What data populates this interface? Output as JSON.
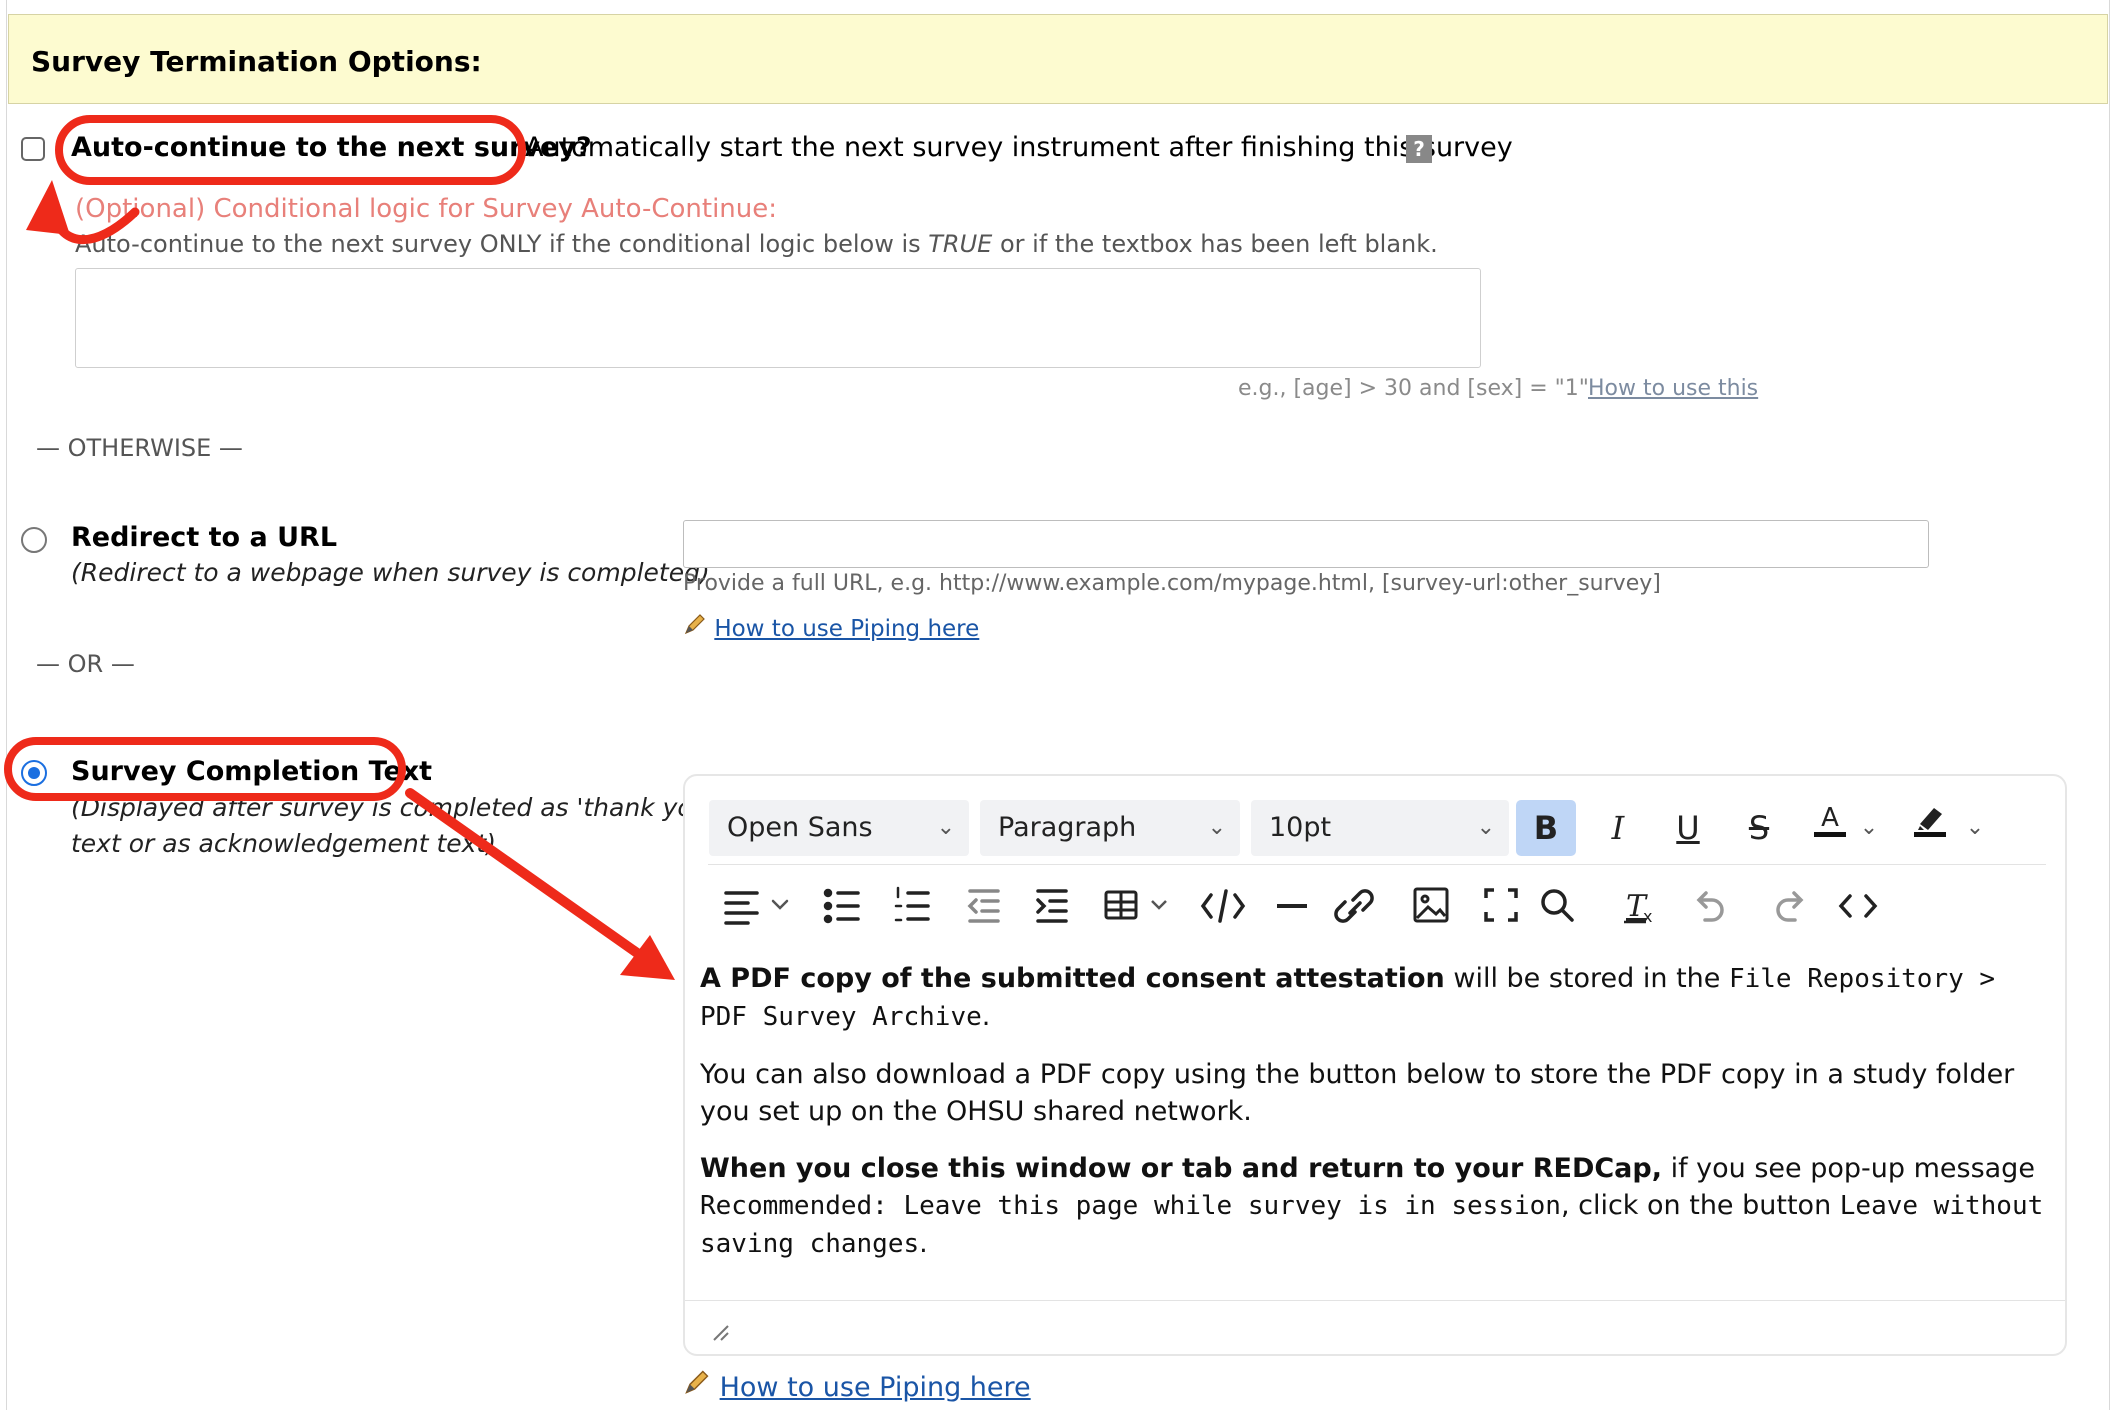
{
  "section": {
    "title": "Survey Termination Options:"
  },
  "auto_continue": {
    "label": "Auto-continue to the next survey?",
    "description": "Automatically start the next survey instrument after finishing this survey",
    "help": "?",
    "optional_prefix": "(Optional)",
    "cond_title": "Conditional logic for Survey Auto-Continue:",
    "cond_desc_a": "Auto-continue to the next survey ONLY if the conditional logic below is ",
    "cond_desc_true": "TRUE",
    "cond_desc_b": " or if the textbox has been left blank.",
    "example": "e.g., [age] > 30 and [sex] = \"1\"",
    "howto": "How to use this"
  },
  "otherwise": "— OTHERWISE —",
  "redirect": {
    "label": "Redirect to a URL",
    "sub": "(Redirect to a webpage when survey is completed)",
    "hint": "Provide a full URL, e.g. http://www.example.com/mypage.html, [survey-url:other_survey]",
    "piping": "How to use Piping here"
  },
  "or": "— OR —",
  "completion": {
    "label": "Survey Completion Text",
    "sub1": "(Displayed after survey is completed as 'thank you'",
    "sub2": "text or as acknowledgement text)",
    "piping": "How to use Piping here"
  },
  "toolbar": {
    "font": "Open Sans",
    "block": "Paragraph",
    "size": "10pt"
  },
  "editor": {
    "p1_bold": "A PDF copy of the submitted consent attestation",
    "p1_text": " will be stored in the ",
    "p1_code": "File Repository > PDF Survey Archive",
    "p1_end": ".",
    "p2": "You can also download a PDF copy using the button below to store the PDF copy in a study folder you set up on the OHSU shared network.",
    "p3_bold": "When you close this window or tab and return to your REDCap,",
    "p3_text": " if you see pop-up message ",
    "p3_code1": "Recommended: Leave this page while survey is in session",
    "p3_text2": ", click on the button ",
    "p3_code2": "Leave without saving changes",
    "p3_end": "."
  },
  "colors": {
    "annotation": "#ee2a1a",
    "header_bg": "#fdfbd0",
    "radio_on": "#1b6fe0"
  }
}
